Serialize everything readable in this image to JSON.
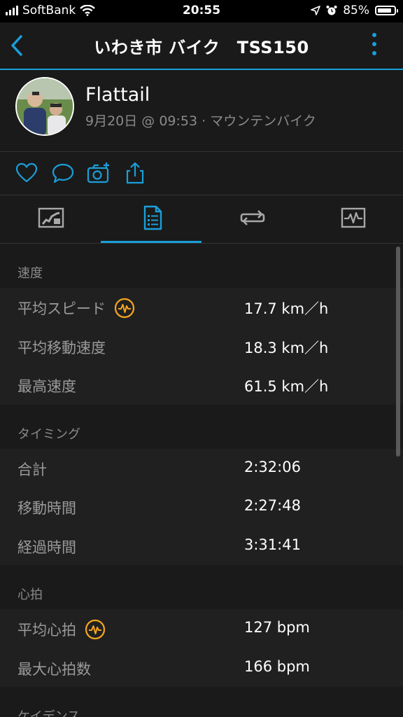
{
  "status_bar": {
    "carrier": "SoftBank",
    "time": "20:55",
    "battery": "85%",
    "battery_level": 0.85
  },
  "header": {
    "title": "いわき市 バイク　TSS150"
  },
  "profile": {
    "name": "Flattail",
    "meta": "9月20日 @ 09:53 · マウンテンバイク"
  },
  "actions": [
    {
      "name": "like",
      "icon": "heart-icon"
    },
    {
      "name": "comment",
      "icon": "comment-icon"
    },
    {
      "name": "add-photo",
      "icon": "camera-plus-icon"
    },
    {
      "name": "share",
      "icon": "share-icon"
    }
  ],
  "tabs": [
    {
      "name": "map",
      "icon": "map-icon",
      "active": false
    },
    {
      "name": "stats",
      "icon": "document-list-icon",
      "active": true
    },
    {
      "name": "laps",
      "icon": "laps-icon",
      "active": false
    },
    {
      "name": "charts",
      "icon": "chart-icon",
      "active": false
    }
  ],
  "sections": {
    "speed": {
      "title": "速度",
      "rows": [
        {
          "label": "平均スピード",
          "value": "17.7 km／h",
          "badge": true
        },
        {
          "label": "平均移動速度",
          "value": "18.3 km／h",
          "badge": false
        },
        {
          "label": "最高速度",
          "value": "61.5 km／h",
          "badge": false
        }
      ]
    },
    "timing": {
      "title": "タイミング",
      "rows": [
        {
          "label": "合計",
          "value": "2:32:06",
          "badge": false
        },
        {
          "label": "移動時間",
          "value": "2:27:48",
          "badge": false
        },
        {
          "label": "経過時間",
          "value": "3:31:41",
          "badge": false
        }
      ]
    },
    "heart": {
      "title": "心拍",
      "rows": [
        {
          "label": "平均心拍",
          "value": "127 bpm",
          "badge": true
        },
        {
          "label": "最大心拍数",
          "value": "166 bpm",
          "badge": false
        }
      ]
    },
    "cadence": {
      "title": "ケイデンス"
    }
  },
  "colors": {
    "accent": "#1a9fd9",
    "badge": "#f5a623",
    "background": "#1a1a1a",
    "row_background": "#202020"
  }
}
